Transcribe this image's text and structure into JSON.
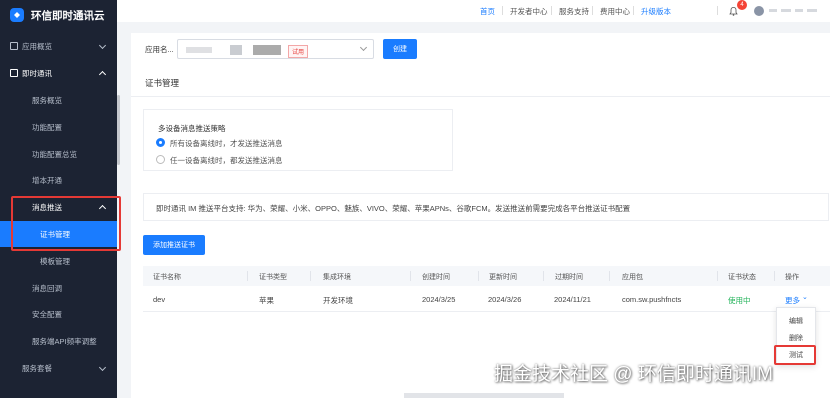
{
  "brand": {
    "name": "环信即时通讯云"
  },
  "sidebar": {
    "overview": "应用概览",
    "im": "即时通讯",
    "service_overview": "服务概览",
    "feature_config": "功能配置",
    "feature_summary": "功能配置总览",
    "feature_enable": "增本开通",
    "push": "消息推送",
    "cert_mgmt": "证书管理",
    "template_mgmt": "模板管理",
    "msg_callback": "消息回调",
    "security": "安全配置",
    "api_rate": "服务端API频率调整",
    "service_plan": "服务套餐"
  },
  "topbar": {
    "home": "首页",
    "dev_center": "开发者中心",
    "support": "服务支持",
    "billing": "费用中心",
    "upgrade": "升级版本",
    "notify_count": "4"
  },
  "app_select": {
    "label": "应用名...",
    "trial_badge": "试用",
    "create_button": "创建"
  },
  "card": {
    "title": "证书管理",
    "policy_title": "多设备消息推送策略",
    "option1": "所有设备离线时，才发送推送消息",
    "option2": "任一设备离线时，都发送推送消息",
    "info": "即时通讯 IM 推送平台支持: 华为、荣耀、小米、OPPO、魅族、VIVO、荣耀、苹果APNs、谷歌FCM。发送推送前需要完成各平台推送证书配置",
    "add_button": "添加推送证书"
  },
  "table": {
    "headers": [
      "证书名称",
      "证书类型",
      "集成环境",
      "创建时间",
      "更新时间",
      "过期时间",
      "应用包",
      "证书状态",
      "操作"
    ],
    "row": {
      "name": "dev",
      "type": "苹果",
      "env": "开发环境",
      "created": "2024/3/25",
      "updated": "2024/3/26",
      "expires": "2024/11/21",
      "package": "com.sw.pushfncts",
      "status": "使用中",
      "more": "更多"
    }
  },
  "dropdown": {
    "edit": "编辑",
    "delete": "删除",
    "test": "测试"
  },
  "watermark": "掘金技术社区 @ 环信即时通讯IM",
  "colors": {
    "accent": "#1a7cff",
    "sidebar_bg": "#1c2333",
    "status_green": "#23b35a",
    "highlight_red": "#e53935"
  }
}
